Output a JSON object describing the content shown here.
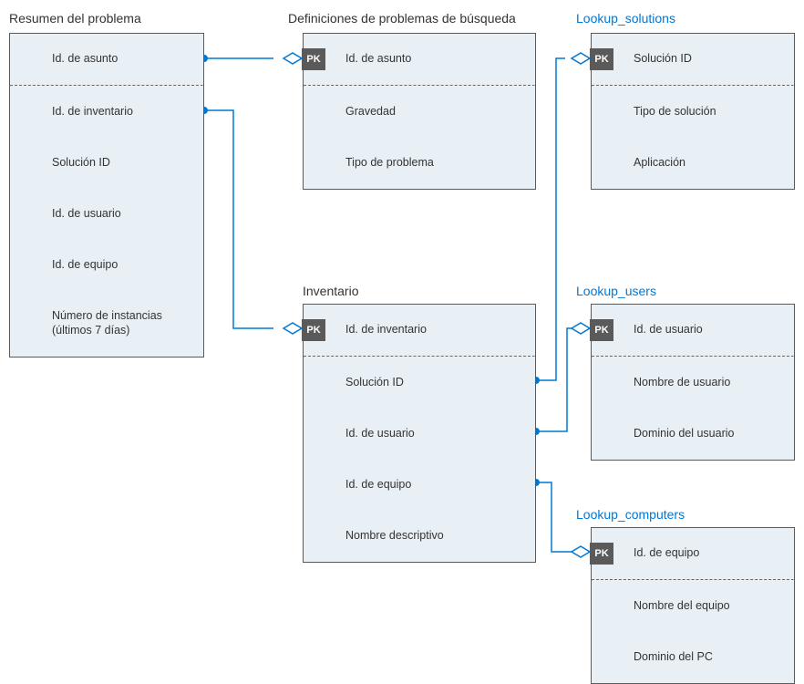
{
  "entities": {
    "resumen": {
      "title": "Resumen del problema",
      "rows": [
        "Id. de asunto",
        "Id. de inventario",
        "Solución   ID",
        "Id. de usuario",
        "Id. de equipo",
        "Número de instancias (últimos 7 días)"
      ]
    },
    "definiciones": {
      "title": "Definiciones de problemas de búsqueda",
      "pk": "PK",
      "rows": [
        "Id. de asunto",
        "Gravedad",
        "Tipo de problema"
      ]
    },
    "lookup_solutions": {
      "title": "Lookup_solutions",
      "pk": "PK",
      "rows": [
        "Solución   ID",
        "Tipo de solución",
        "Aplicación"
      ]
    },
    "inventario": {
      "title": "Inventario",
      "pk": "PK",
      "rows": [
        "Id. de inventario",
        "Solución   ID",
        "Id. de usuario",
        "Id. de equipo",
        "Nombre descriptivo"
      ]
    },
    "lookup_users": {
      "title": "Lookup_users",
      "pk": "PK",
      "rows": [
        "Id. de usuario",
        "Nombre de usuario",
        "Dominio del usuario"
      ]
    },
    "lookup_computers": {
      "title": "Lookup_computers",
      "pk": "PK",
      "rows": [
        "Id. de equipo",
        "Nombre del equipo",
        "Dominio del PC"
      ]
    }
  }
}
